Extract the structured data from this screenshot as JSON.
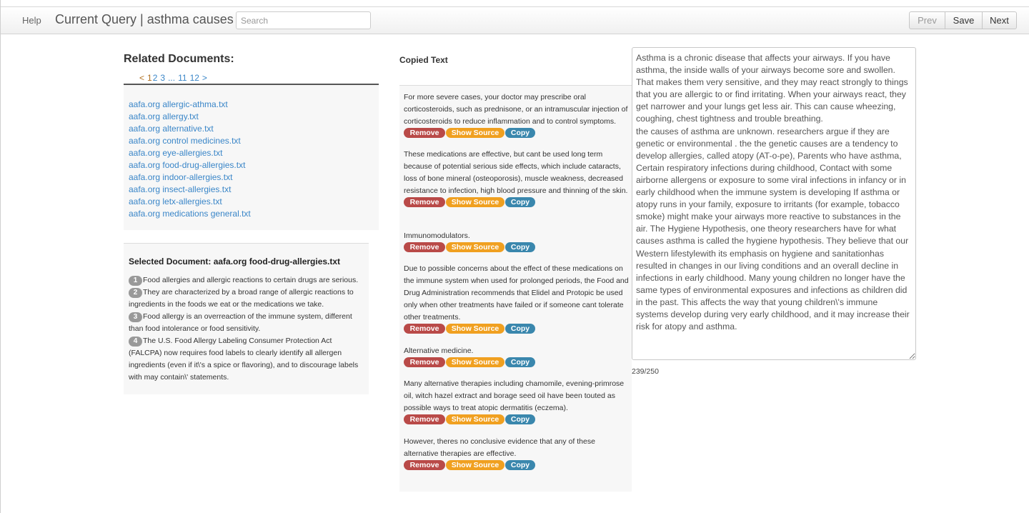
{
  "navbar": {
    "help": "Help",
    "title": "Current Query | asthma causes",
    "search_placeholder": "Search",
    "prev": "Prev",
    "save": "Save",
    "next": "Next"
  },
  "related": {
    "title": "Related Documents:",
    "pager": {
      "prev": "<",
      "current": "1",
      "p2": "2",
      "p3": "3",
      "ellipsis": "...",
      "p11": "11",
      "p12": "12",
      "next": ">"
    },
    "documents": [
      "aafa.org allergic-athma.txt",
      "aafa.org allergy.txt",
      "aafa.org alternative.txt",
      "aafa.org control medicines.txt",
      "aafa.org eye-allergies.txt",
      "aafa.org food-drug-allergies.txt",
      "aafa.org indoor-allergies.txt",
      "aafa.org insect-allergies.txt",
      "aafa.org letx-allergies.txt",
      "aafa.org medications general.txt"
    ]
  },
  "selected": {
    "title": "Selected Document: aafa.org food-drug-allergies.txt",
    "sentences": [
      {
        "num": "1",
        "text": "Food allergies and allergic reactions to certain drugs are serious."
      },
      {
        "num": "2",
        "text": "They are characterized by a broad range of allergic reactions to ingredients in the foods we eat or the medications we take."
      },
      {
        "num": "3",
        "text": "Food allergy is an overreaction of the immune system, different than food intolerance or food sensitivity."
      },
      {
        "num": "4",
        "text": "The U.S. Food Allergy Labeling Consumer Protection Act (FALCPA) now requires food labels to clearly identify all allergen ingredients (even if it\\'s a spice or flavoring), and to discourage labels with may contain\\' statements."
      }
    ]
  },
  "copied": {
    "title": "Copied Text",
    "actions": {
      "remove": "Remove",
      "source": "Show Source",
      "copy": "Copy"
    },
    "snippets": [
      "For more severe cases, your doctor may prescribe oral corticosteroids, such as prednisone, or an intramuscular injection of corticosteroids to reduce inflammation and to control symptoms.",
      "These medications are effective, but cant be used long term because of potential serious side effects, which include cataracts, loss of bone mineral (osteoporosis), muscle weakness, decreased resistance to infection, high blood pressure and thinning of the skin.",
      "Immunomodulators.",
      "Due to possible concerns about the effect of these medications on the immune system when used for prolonged periods, the Food and Drug Administration recommends that Elidel and Protopic be used only when other treatments have failed or if someone cant tolerate other treatments.",
      "Alternative medicine.",
      "Many alternative therapies including chamomile, evening-primrose oil, witch hazel extract and borage seed oil have been touted as possible ways to treat atopic dermatitis (eczema).",
      "However, theres no conclusive evidence that any of these alternative therapies are effective."
    ]
  },
  "editor": {
    "text": "Asthma is a chronic disease that affects your airways. If you have asthma, the inside walls of your airways become sore and swollen. That makes them very sensitive, and they may react strongly to things that you are allergic to or find irritating. When your airways react, they get narrower and your lungs get less air. This can cause wheezing, coughing, chest tightness and trouble breathing.\nthe causes of asthma are unknown. researchers argue if they are genetic or environmental . the the genetic causes are a tendency to develop allergies, called atopy (AT-o-pe), Parents who have asthma, Certain respiratory infections during childhood, Contact with some airborne allergens or exposure to some viral infections in infancy or in early childhood when the immune system is developing If asthma or atopy runs in your family, exposure to irritants (for example, tobacco smoke) might make your airways more reactive to substances in the air. The Hygiene Hypothesis, one theory researchers have for what causes asthma is called the hygiene hypothesis. They believe that our Western lifestylewith its emphasis on hygiene and sanitationhas resulted in changes in our living conditions and an overall decline in infections in early childhood. Many young children no longer have the same types of environmental exposures and infections as children did in the past. This affects the way that young children\\'s immune systems develop during very early childhood, and it may increase their risk for atopy and asthma.",
    "counter": "239/250"
  }
}
